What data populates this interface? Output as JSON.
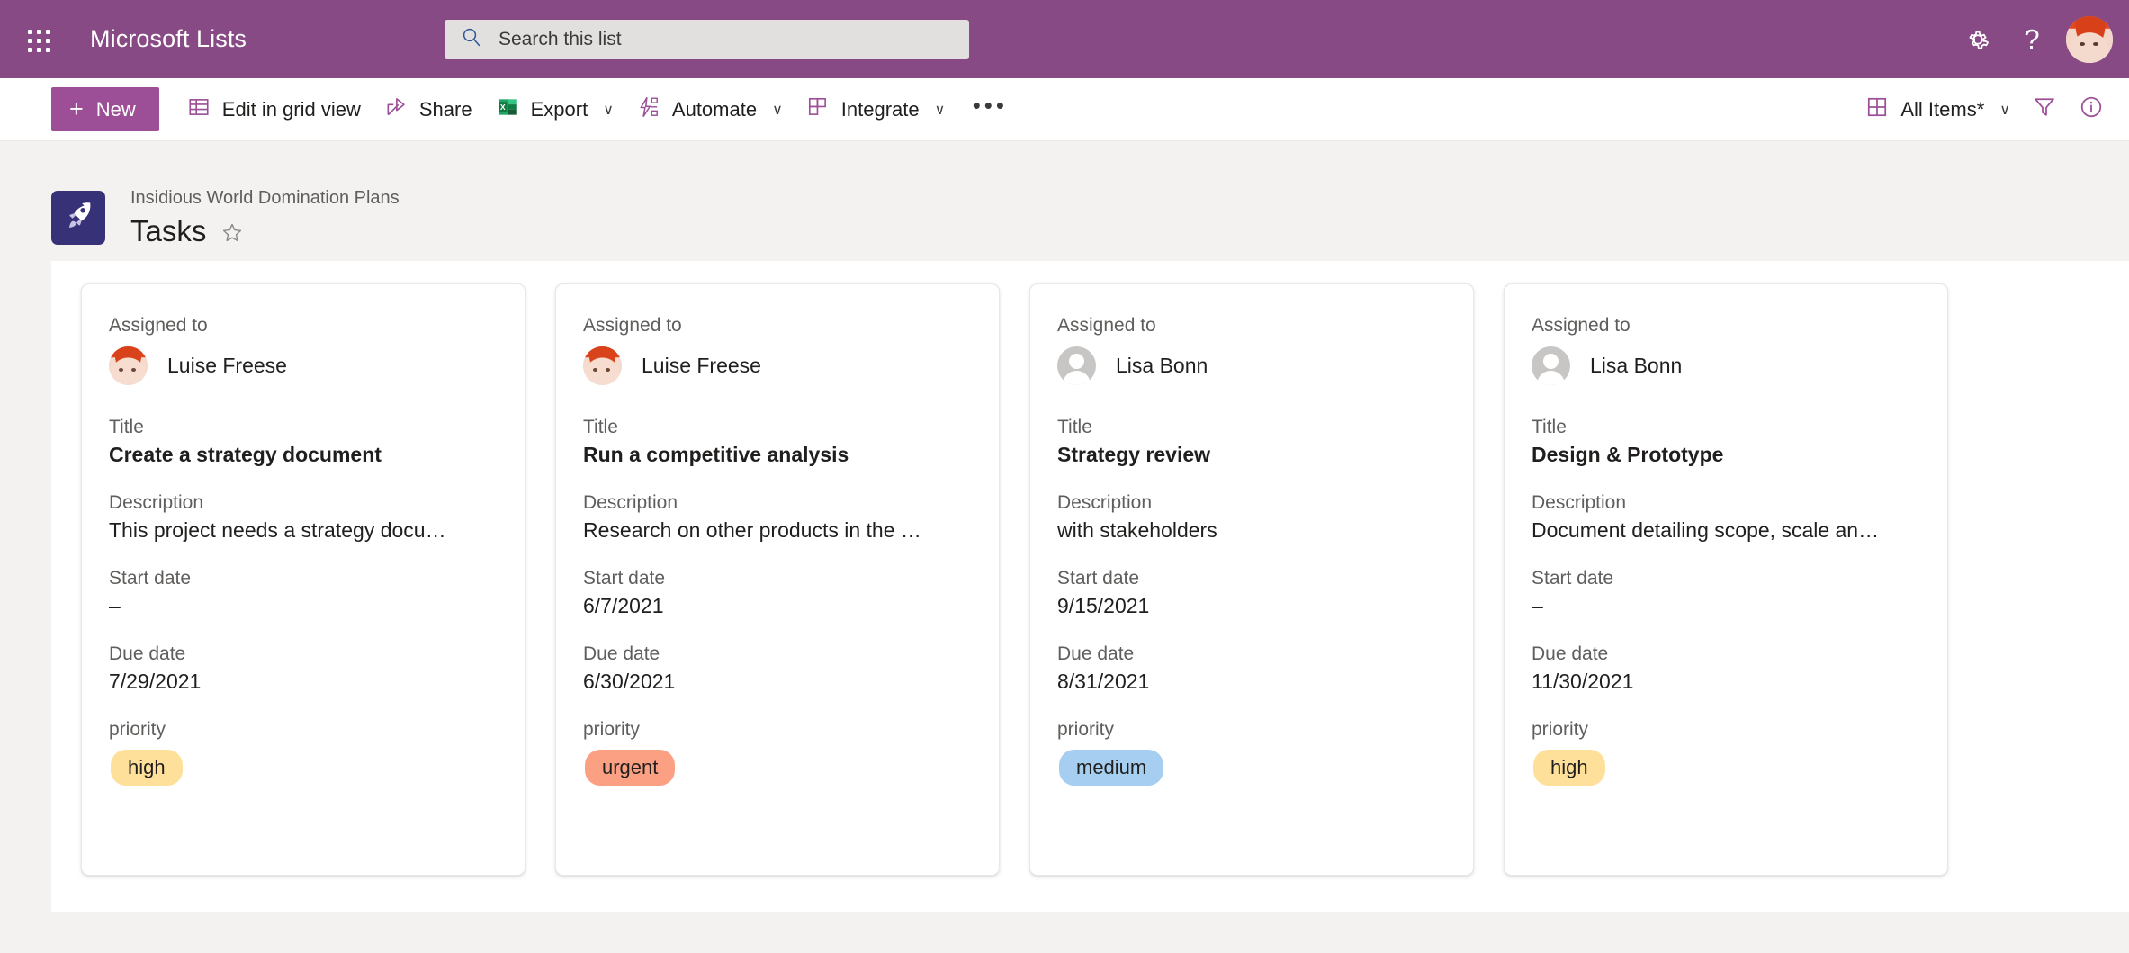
{
  "suite": {
    "waffle_icon": "app-launcher-icon",
    "app_title": "Microsoft Lists",
    "search": {
      "placeholder": "Search this list",
      "icon": "search-icon"
    },
    "settings_icon": "gear-icon",
    "help_icon": "help-icon",
    "avatar": "user-avatar"
  },
  "command_bar": {
    "new_label": "New",
    "items": [
      {
        "label": "Edit in grid view",
        "icon": "grid-view-icon",
        "chevron": false
      },
      {
        "label": "Share",
        "icon": "share-icon",
        "chevron": false
      },
      {
        "label": "Export",
        "icon": "excel-icon",
        "chevron": true
      },
      {
        "label": "Automate",
        "icon": "automate-icon",
        "chevron": true
      },
      {
        "label": "Integrate",
        "icon": "integrate-icon",
        "chevron": true
      }
    ],
    "overflow_label": "•••",
    "view_label": "All Items*",
    "view_icon": "view-grid-icon",
    "filter_icon": "filter-funnel-icon",
    "info_icon": "info-circle-icon",
    "chevron_glyph": "∨"
  },
  "list_header": {
    "logo_icon": "rocket-icon",
    "site_name": "Insidious World Domination Plans",
    "title": "Tasks",
    "favorite_icon": "star-icon"
  },
  "field_labels": {
    "assigned_to": "Assigned to",
    "title": "Title",
    "description": "Description",
    "start_date": "Start date",
    "due_date": "Due date",
    "priority": "priority"
  },
  "colors": {
    "suite_bar": "#884a85",
    "new_button": "#9c4f97",
    "accent_purple": "#9c4f97",
    "logo_background": "#373277",
    "pill_high": "#ffe09a",
    "pill_urgent": "#fba083",
    "pill_medium": "#a5cef0",
    "page_background": "#f3f2f1"
  },
  "cards": [
    {
      "assigned_to": "Luise Freese",
      "avatar_type": "photo",
      "title": "Create a strategy document",
      "description": "This project needs a strategy docu…",
      "start_date": "–",
      "due_date": "7/29/2021",
      "priority": "high",
      "priority_class": "high"
    },
    {
      "assigned_to": "Luise Freese",
      "avatar_type": "photo",
      "title": "Run a competitive analysis",
      "description": "Research on other products in the …",
      "start_date": "6/7/2021",
      "due_date": "6/30/2021",
      "priority": "urgent",
      "priority_class": "urgent"
    },
    {
      "assigned_to": "Lisa Bonn",
      "avatar_type": "generic",
      "title": "Strategy review",
      "description": "with stakeholders",
      "start_date": "9/15/2021",
      "due_date": "8/31/2021",
      "priority": "medium",
      "priority_class": "medium"
    },
    {
      "assigned_to": "Lisa Bonn",
      "avatar_type": "generic",
      "title": "Design & Prototype",
      "description": "Document detailing scope, scale an…",
      "start_date": "–",
      "due_date": "11/30/2021",
      "priority": "high",
      "priority_class": "high"
    }
  ]
}
